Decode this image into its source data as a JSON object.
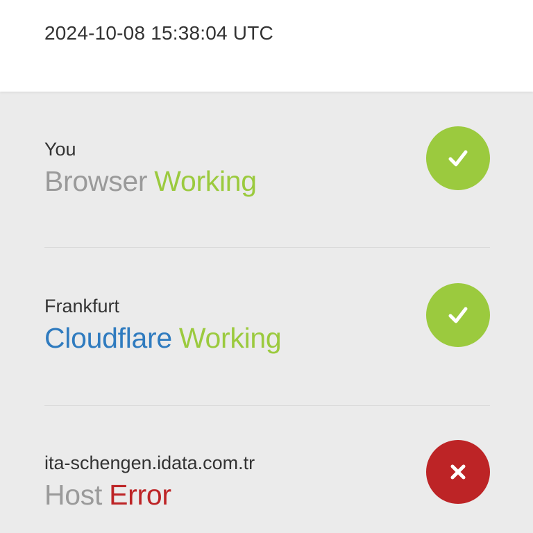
{
  "header": {
    "timestamp": "2024-10-08 15:38:04 UTC"
  },
  "colors": {
    "working": "#9bca3e",
    "error": "#bd2426",
    "cloudflare": "#2f7bbf",
    "muted": "#9a9a9a",
    "text": "#333333"
  },
  "items": [
    {
      "location": "You",
      "type": "Browser",
      "status": "Working",
      "state": "ok",
      "icon": "checkmark-icon"
    },
    {
      "location": "Frankfurt",
      "type": "Cloudflare",
      "status": "Working",
      "state": "ok",
      "icon": "checkmark-icon"
    },
    {
      "location": "ita-schengen.idata.com.tr",
      "type": "Host",
      "status": "Error",
      "state": "error",
      "icon": "x-icon"
    }
  ]
}
